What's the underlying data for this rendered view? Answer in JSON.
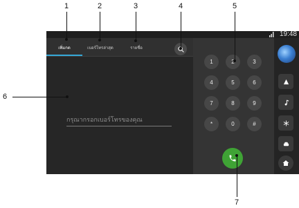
{
  "callouts": [
    "1",
    "2",
    "3",
    "4",
    "5",
    "6",
    "7"
  ],
  "status_bar": {
    "time": "19:48"
  },
  "tabs": [
    {
      "label": "เพิ่มกด",
      "active": true
    },
    {
      "label": "เบอร์โทรล่าสุด",
      "active": false
    },
    {
      "label": "รายชื่อ",
      "active": false
    }
  ],
  "input": {
    "placeholder": "กรุณากรอกเบอร์โทรของคุณ",
    "value": ""
  },
  "keypad": [
    "1",
    "2",
    "3",
    "4",
    "5",
    "6",
    "7",
    "8",
    "9",
    "*",
    "0",
    "#"
  ],
  "icons": {
    "search": "search-icon",
    "call": "phone-call-icon",
    "nav": "navigation-arrow-icon",
    "music": "music-note-icon",
    "settings": "snowflake-icon",
    "car": "car-icon",
    "home": "home-icon",
    "signal": "signal-icon"
  },
  "colors": {
    "accent": "#35a8d8",
    "call": "#3fa335",
    "background": "#2b2b2b"
  }
}
